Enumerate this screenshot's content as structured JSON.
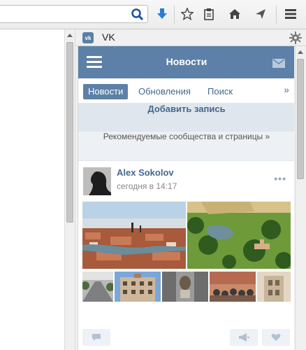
{
  "browser": {
    "toolbar_icons": [
      "search-icon",
      "download-icon",
      "bookmark-star-icon",
      "reading-list-icon",
      "home-icon",
      "send-icon",
      "menu-icon"
    ]
  },
  "sidebar": {
    "title": "VK",
    "logo_text": "vk"
  },
  "vk": {
    "header_title": "Новости",
    "tabs": [
      "Новости",
      "Обновления",
      "Поиск"
    ],
    "more": "»",
    "add_post": "Добавить запись",
    "recommended": "Рекомендуемые сообщества и страницы »",
    "post": {
      "author": "Alex Sokolov",
      "time": "сегодня в 14:17",
      "menu": "•••"
    }
  },
  "colors": {
    "vk_blue": "#5d80a8",
    "link": "#45688e",
    "accent_download": "#2a7ed3"
  }
}
